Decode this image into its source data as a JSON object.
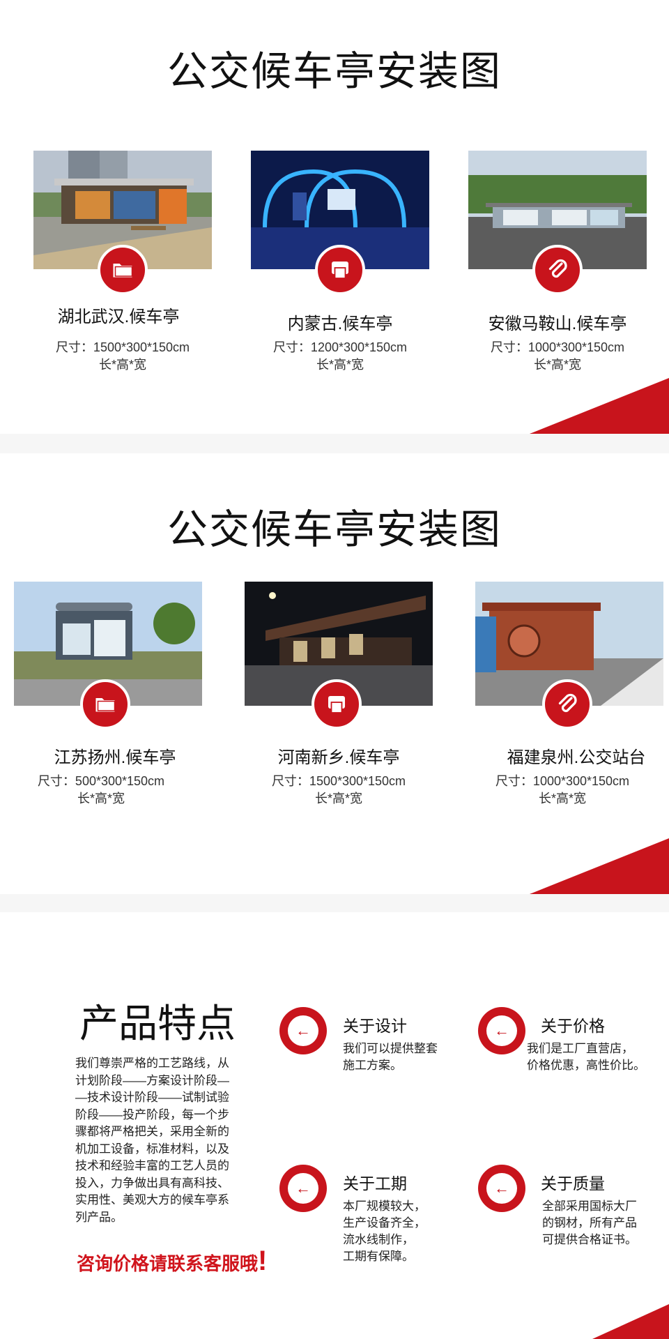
{
  "section1": {
    "title": "公交候车亭安装图",
    "cards": [
      {
        "name": "湖北武汉.候车亭",
        "size": "尺寸：1500*300*150cm",
        "dims": "长*高*宽",
        "badge_icon": "folder-icon"
      },
      {
        "name": "内蒙古.候车亭",
        "size": "尺寸：1200*300*150cm",
        "dims": "长*高*宽",
        "badge_icon": "printer-icon"
      },
      {
        "name": "安徽马鞍山.候车亭",
        "size": "尺寸：1000*300*150cm",
        "dims": "长*高*宽",
        "badge_icon": "paperclip-icon"
      }
    ]
  },
  "section2": {
    "title": "公交候车亭安装图",
    "cards": [
      {
        "name": "江苏扬州.候车亭",
        "size": "尺寸：500*300*150cm",
        "dims": "长*高*宽",
        "badge_icon": "folder-icon"
      },
      {
        "name": "河南新乡.候车亭",
        "size": "尺寸：1500*300*150cm",
        "dims": "长*高*宽",
        "badge_icon": "printer-icon"
      },
      {
        "name": "福建泉州.公交站台",
        "size": "尺寸：1000*300*150cm",
        "dims": "长*高*宽",
        "badge_icon": "paperclip-icon"
      }
    ]
  },
  "features": {
    "title": "产品特点",
    "desc_lines": [
      "我们尊崇严格的工艺路线，从",
      "计划阶段——方案设计阶段—",
      "—技术设计阶段——试制试验",
      "阶段——投产阶段，每一个步",
      "骤都将严格把关，采用全新的",
      "机加工设备，标准材料，以及",
      "技术和经验丰富的工艺人员的",
      "投入，力争做出具有高科技、",
      "实用性、美观大方的候车亭系",
      "列产品。"
    ],
    "cta": "咨询价格请联系客服哦",
    "cta_mark": "!",
    "items": [
      {
        "title": "关于设计",
        "lines": [
          "我们可以提供整套",
          "施工方案。"
        ],
        "icon": "arrow-left-icon"
      },
      {
        "title": "关于价格",
        "lines": [
          "我们是工厂直营店，",
          "价格优惠，高性价比。"
        ],
        "icon": "arrow-left-icon"
      },
      {
        "title": "关于工期",
        "lines": [
          "本厂规模较大，",
          "生产设备齐全，",
          "流水线制作，",
          "工期有保障。"
        ],
        "icon": "arrow-left-icon"
      },
      {
        "title": "关于质量",
        "lines": [
          "全部采用国标大厂",
          "的钢材，所有产品",
          "可提供合格证书。"
        ],
        "icon": "arrow-left-icon"
      }
    ]
  },
  "colors": {
    "accent": "#c8141c",
    "background": "#ffffff",
    "page": "#f6f6f6"
  }
}
